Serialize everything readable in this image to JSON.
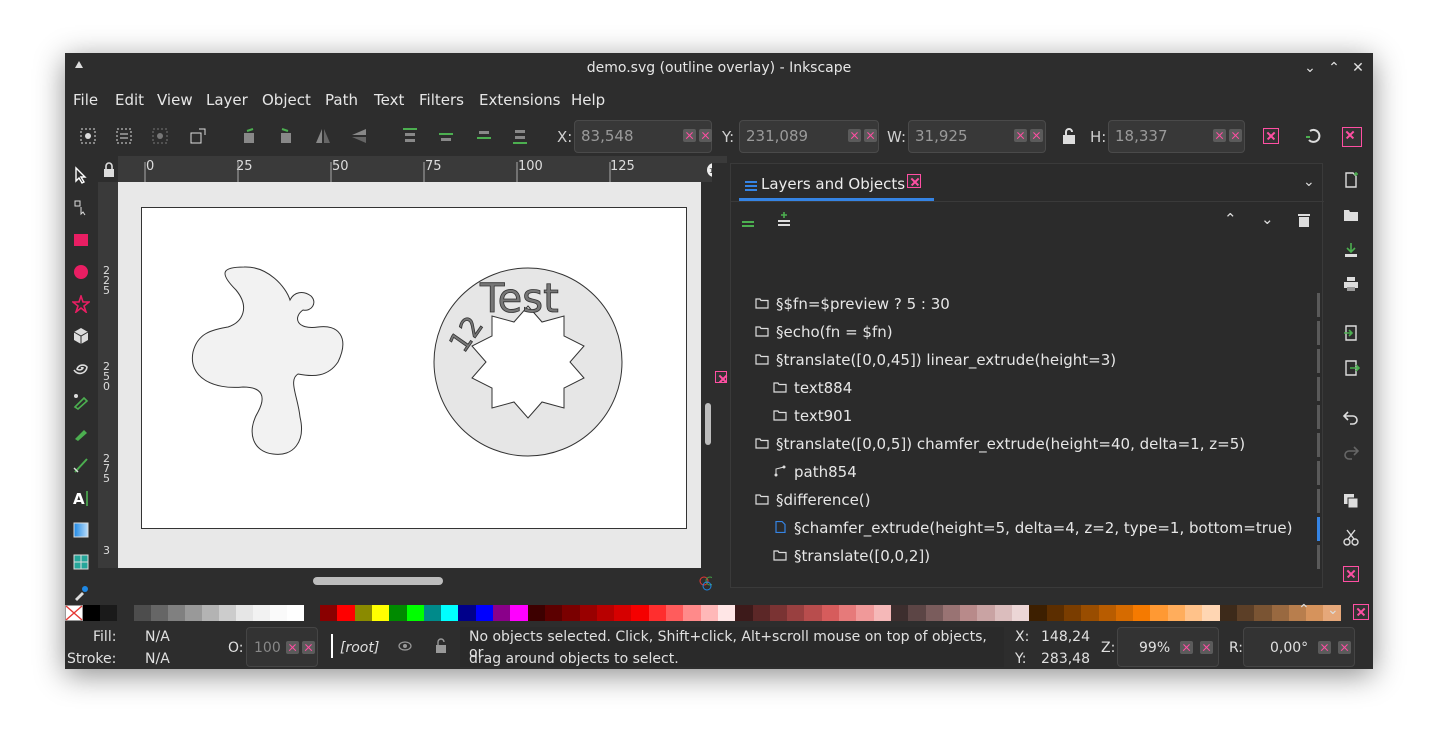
{
  "window": {
    "title": "demo.svg (outline overlay) - Inkscape"
  },
  "menu": [
    "File",
    "Edit",
    "View",
    "Layer",
    "Object",
    "Path",
    "Text",
    "Filters",
    "Extensions",
    "Help"
  ],
  "toolbar": {
    "x_label": "X:",
    "x_value": "83,548",
    "y_label": "Y:",
    "y_value": "231,089",
    "w_label": "W:",
    "w_value": "31,925",
    "h_label": "H:",
    "h_value": "18,337"
  },
  "ruler": {
    "top_ticks": [
      "0",
      "25",
      "50",
      "75",
      "100",
      "125"
    ]
  },
  "canvas": {
    "test_text": "Test",
    "number_text": "12"
  },
  "panel": {
    "tab_label": "Layers and Objects",
    "rows": [
      {
        "label": "§$fn=$preview ? 5 : 30",
        "icon": "folder-icon"
      },
      {
        "label": "§echo(fn = $fn)",
        "icon": "folder-icon"
      },
      {
        "label": "§translate([0,0,45]) linear_extrude(height=3)",
        "icon": "folder-icon"
      },
      {
        "label": "text884",
        "icon": "folder-icon"
      },
      {
        "label": "text901",
        "icon": "folder-icon"
      },
      {
        "label": "§translate([0,0,5]) chamfer_extrude(height=40, delta=1, z=5)",
        "icon": "folder-icon"
      },
      {
        "label": "path854",
        "icon": "path-icon"
      },
      {
        "label": "§difference()",
        "icon": "folder-icon"
      },
      {
        "label": "§chamfer_extrude(height=5, delta=4, z=2, type=1, bottom=true)",
        "icon": "document-icon"
      },
      {
        "label": "§translate([0,0,2])",
        "icon": "folder-icon"
      }
    ]
  },
  "status": {
    "fill_label": "Fill:",
    "fill_value": "N/A",
    "stroke_label": "Stroke:",
    "stroke_value": "N/A",
    "opacity_label": "O:",
    "opacity_value": "100",
    "layer": "[root]",
    "message_line1": "No objects selected. Click, Shift+click, Alt+scroll mouse on top of objects, or",
    "message_line2": "drag around objects to select.",
    "cursor_x_label": "X:",
    "cursor_x": "148,24",
    "cursor_y_label": "Y:",
    "cursor_y": "283,48",
    "zoom_label": "Z:",
    "zoom": "99%",
    "rotation_label": "R:",
    "rotation": "0,00°"
  },
  "palette": [
    "#8a0000",
    "#ff0000",
    "#8a8a00",
    "#ffff00",
    "#008a00",
    "#00ff00",
    "#008a8a",
    "#00ffff",
    "#00008a",
    "#0000ff",
    "#8a008a",
    "#ff00ff",
    "#3d0000",
    "#5c0000",
    "#7a0000",
    "#990000",
    "#b80000",
    "#d60000",
    "#f50000",
    "#ff2e2e",
    "#ff5c5c",
    "#ff8a8a",
    "#ffb8b8",
    "#ffe6e6",
    "#3d1a1a",
    "#5c2727",
    "#7a3333",
    "#994040",
    "#b84d4d",
    "#d65c5c",
    "#e67a7a",
    "#f09999",
    "#f5b8b8",
    "#3d2e2e",
    "#5c4545",
    "#7a5c5c",
    "#997373",
    "#b88a8a",
    "#c9a3a3",
    "#dbbdbd",
    "#ecd6d6",
    "#3d1f00",
    "#5c2e00",
    "#7a3d00",
    "#994d00",
    "#b85c00",
    "#d66b00",
    "#f57a00",
    "#ff9933",
    "#ffad5c",
    "#ffc28a",
    "#ffd6b3",
    "#3d2a1a",
    "#5c3f27",
    "#7a5433",
    "#996940",
    "#b87e4d",
    "#d6935c",
    "#e6a87a"
  ]
}
